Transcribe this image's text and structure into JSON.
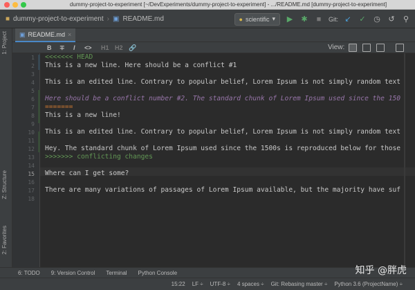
{
  "window": {
    "title": "dummy-project-to-experiment [~/DevExperiments/dummy-project-to-experiment] - .../README.md [dummy-project-to-experiment]"
  },
  "navbar": {
    "project": "dummy-project-to-experiment",
    "file": "README.md",
    "run_config": "scientific",
    "git_label": "Git:",
    "icons": [
      "folder-icon",
      "markdown-file-icon",
      "run-icon",
      "debug-icon",
      "stop-icon",
      "vcs-update-icon",
      "vcs-commit-icon",
      "history-icon",
      "revert-icon",
      "search-icon"
    ]
  },
  "left_tabs": {
    "project": "1: Project",
    "structure": "Z: Structure",
    "favorites": "2: Favorites"
  },
  "editor_tab": {
    "label": "README.md"
  },
  "md_toolbar": {
    "bold": "B",
    "strike": "∓",
    "italic": "I",
    "code": "<>",
    "h1": "H1",
    "h2": "H2",
    "link": "🔗",
    "view_label": "View:"
  },
  "editor": {
    "line_numbers": [
      "1",
      "2",
      "3",
      "4",
      "5",
      "6",
      "7",
      "8",
      "9",
      "10",
      "11",
      "12",
      "13",
      "14",
      "15",
      "16",
      "17",
      "18"
    ],
    "current_line": "15",
    "lines": [
      "<<<<<<< HEAD",
      "This is a new line. Here should be a conflict #1",
      "",
      "This is an edited line. Contrary to popular belief, Lorem Ipsum is not simply random text",
      "",
      "Here should be a conflict number #2. The standard chunk of Lorem Ipsum used since the 150",
      "=======",
      "This is a new line!",
      "",
      "This is an edited line. Contrary to popular belief, Lorem Ipsum is not simply random text",
      "",
      "Hey. The standard chunk of Lorem Ipsum used since the 1500s is reproduced below for those",
      ">>>>>>> conflicting changes",
      "",
      "Where can I get some?",
      "",
      "There are many variations of passages of Lorem Ipsum available, but the majority have suf",
      ""
    ]
  },
  "bottom_tools": {
    "todo": "6: TODO",
    "vcs": "9: Version Control",
    "terminal": "Terminal",
    "python_console": "Python Console"
  },
  "status": {
    "position": "15:22",
    "line_sep": "LF ÷",
    "encoding": "UTF-8 ÷",
    "indent": "4 spaces ÷",
    "git": "Git: Rebasing master ÷",
    "interpreter": "Python 3.6 (ProjectName) ÷"
  },
  "watermark": "知乎 @胖虎"
}
